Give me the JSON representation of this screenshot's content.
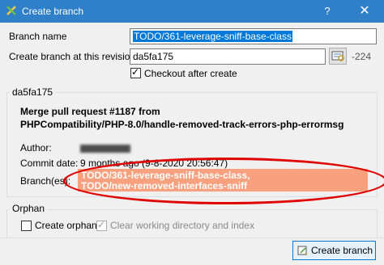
{
  "window": {
    "title": "Create branch",
    "help_glyph": "?",
    "close_glyph": "✕"
  },
  "form": {
    "branch_name_label": "Branch name",
    "branch_name_value": "TODO/361-leverage-sniff-base-class",
    "revision_label": "Create branch at this revision",
    "revision_value": "da5fa175",
    "revision_number": "-224",
    "checkout_label": "Checkout after create",
    "checkout_checked": true
  },
  "commit_group": {
    "title": "da5fa175",
    "subject_line1": "Merge pull request #1187 from",
    "subject_line2": "PHPCompatibility/PHP-8.0/handle-removed-track-errors-php-errormsg",
    "author_label": "Author:",
    "commit_date_label": "Commit date:",
    "commit_date_value": "9 months ago (9-8-2020 20:56:47)",
    "branches_label": "Branch(es):",
    "branches": [
      "TODO/361-leverage-sniff-base-class,",
      "TODO/new-removed-interfaces-sniff"
    ]
  },
  "orphan_group": {
    "title": "Orphan",
    "create_orphan_label": "Create orphan",
    "clear_dir_label": "Clear working directory and index"
  },
  "footer": {
    "create_button_label": "Create branch"
  },
  "colors": {
    "titlebar": "#2f7fc9",
    "selection": "#0078d7",
    "branch_highlight": "#f9a07e",
    "annotation": "#e00000"
  }
}
